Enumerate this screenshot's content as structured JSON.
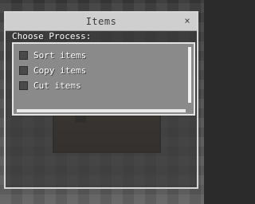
{
  "window": {
    "title": "Items",
    "close_glyph": "×",
    "close_icon": "close-icon"
  },
  "prompt": "Choose Process:",
  "process_list": {
    "items": [
      {
        "label": "Sort items",
        "checked": false
      },
      {
        "label": "Copy items",
        "checked": false
      },
      {
        "label": "Cut items",
        "checked": false
      }
    ]
  },
  "colors": {
    "titlebar": "#cfcfcf",
    "list_background": "#8a8a8a",
    "checkbox": "#4a4a4a",
    "text": "#ffffff"
  }
}
